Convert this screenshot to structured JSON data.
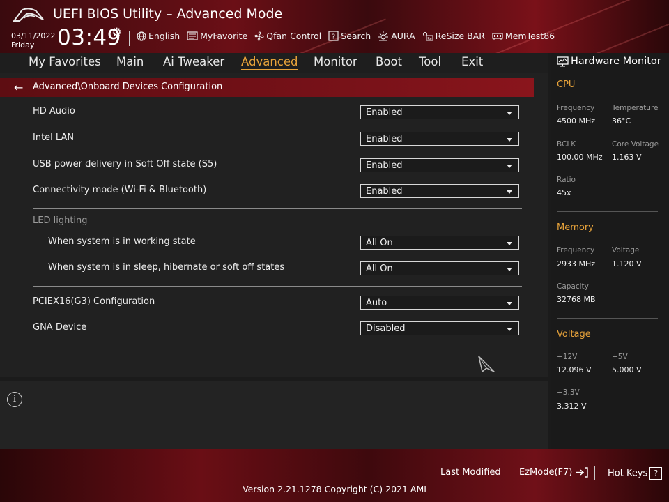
{
  "header": {
    "title": "UEFI BIOS Utility – Advanced Mode",
    "date": "03/11/2022",
    "day": "Friday",
    "time": "03:49",
    "tools": [
      {
        "label": "English",
        "icon": "globe-icon"
      },
      {
        "label": "MyFavorite",
        "icon": "favorite-icon"
      },
      {
        "label": "Qfan Control",
        "icon": "fan-icon"
      },
      {
        "label": "Search",
        "icon": "search-icon"
      },
      {
        "label": "AURA",
        "icon": "aura-icon"
      },
      {
        "label": "ReSize BAR",
        "icon": "resize-bar-icon"
      },
      {
        "label": "MemTest86",
        "icon": "memtest-icon"
      }
    ]
  },
  "nav": {
    "tabs": [
      "My Favorites",
      "Main",
      "Ai Tweaker",
      "Advanced",
      "Monitor",
      "Boot",
      "Tool",
      "Exit"
    ],
    "active": "Advanced"
  },
  "breadcrumb": "Advanced\\Onboard Devices Configuration",
  "settings": [
    {
      "label": "HD Audio",
      "value": "Enabled"
    },
    {
      "label": "Intel LAN",
      "value": "Enabled"
    },
    {
      "label": "USB power delivery in Soft Off state (S5)",
      "value": "Enabled"
    },
    {
      "label": "Connectivity mode (Wi-Fi & Bluetooth)",
      "value": "Enabled"
    },
    {
      "label": "LED lighting"
    },
    {
      "label": "When system is in working state",
      "value": "All On"
    },
    {
      "label": "When system is in sleep, hibernate or soft off states",
      "value": "All On"
    },
    {
      "label": "PCIEX16(G3) Configuration",
      "value": "Auto"
    },
    {
      "label": "GNA Device",
      "value": "Disabled"
    }
  ],
  "hardware_monitor": {
    "title": "Hardware Monitor",
    "cpu": {
      "heading": "CPU",
      "frequency_label": "Frequency",
      "frequency": "4500 MHz",
      "temperature_label": "Temperature",
      "temperature": "36°C",
      "bclk_label": "BCLK",
      "bclk": "100.00 MHz",
      "core_voltage_label": "Core Voltage",
      "core_voltage": "1.163 V",
      "ratio_label": "Ratio",
      "ratio": "45x"
    },
    "memory": {
      "heading": "Memory",
      "frequency_label": "Frequency",
      "frequency": "2933 MHz",
      "voltage_label": "Voltage",
      "voltage": "1.120 V",
      "capacity_label": "Capacity",
      "capacity": "32768 MB"
    },
    "voltage": {
      "heading": "Voltage",
      "v12_label": "+12V",
      "v12": "12.096 V",
      "v5_label": "+5V",
      "v5": "5.000 V",
      "v33_label": "+3.3V",
      "v33": "3.312 V"
    }
  },
  "footer": {
    "last_modified": "Last Modified",
    "ezmode": "EzMode(F7)",
    "hot_keys": "Hot Keys",
    "hot_keys_key": "?",
    "version": "Version 2.21.1278 Copyright (C) 2021 AMI"
  },
  "colors": {
    "accent": "#e8a33a",
    "brand_red": "#7a1219",
    "panel": "#212121"
  }
}
